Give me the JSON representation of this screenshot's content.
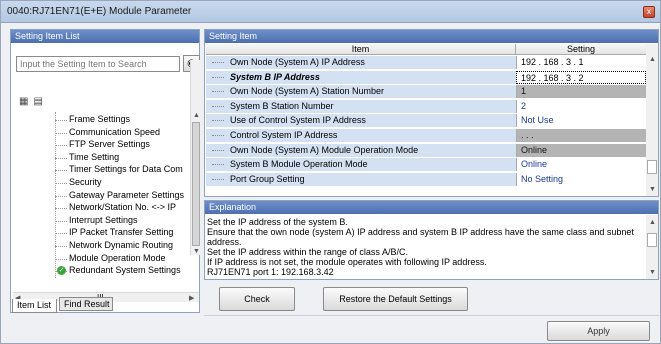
{
  "window": {
    "title": "0040:RJ71EN71(E+E) Module Parameter",
    "close_label": "x"
  },
  "left": {
    "header": "Setting Item List",
    "search_placeholder": "Input the Setting Item to Search",
    "tree_items": [
      "Frame Settings",
      "Communication Speed",
      "FTP Server Settings",
      "Time Setting",
      "Timer Settings for Data Com",
      "Security",
      "Gateway Parameter Settings",
      "Network/Station No. <-> IP",
      "Interrupt Settings",
      "IP Packet Transfer Setting",
      "Network Dynamic Routing",
      "Module Operation Mode",
      "Redundant System Settings"
    ],
    "hscroll_label": "III",
    "tabs": [
      "Item List",
      "Find Result"
    ]
  },
  "right": {
    "header": "Setting Item",
    "col_item": "Item",
    "col_setting": "Setting",
    "rows": [
      {
        "name": "Own Node (System A) IP Address",
        "value": "192 . 168 . 3 . 1",
        "style": "black"
      },
      {
        "name": "System B IP Address",
        "value": "192 . 168 . 3 . 2",
        "style": "dotted",
        "bold": true
      },
      {
        "name": "Own Node (System A) Station Number",
        "value": "1",
        "style": "gray"
      },
      {
        "name": "System B Station Number",
        "value": "2",
        "style": "normal"
      },
      {
        "name": "Use of Control System IP Address",
        "value": "Not Use",
        "style": "normal"
      },
      {
        "name": "Control System IP Address",
        "value": ". . .",
        "style": "gray"
      },
      {
        "name": "Own Node (System A) Module Operation Mode",
        "value": "Online",
        "style": "gray"
      },
      {
        "name": "System B Module Operation Mode",
        "value": "Online",
        "style": "normal"
      },
      {
        "name": "Port Group Setting",
        "value": "No Setting",
        "style": "normal"
      }
    ]
  },
  "explanation": {
    "header": "Explanation",
    "lines": [
      "Set the IP address of the system B.",
      "Ensure that the own node (system A) IP address and system B IP address have the same class and subnet",
      "address.",
      "Set the IP address within the range of class A/B/C.",
      "If IP address is not set, the module operates with following IP address.",
      "RJ71EN71 port 1: 192.168.3.42"
    ]
  },
  "buttons": {
    "check": "Check",
    "restore": "Restore the Default Settings",
    "apply": "Apply"
  }
}
